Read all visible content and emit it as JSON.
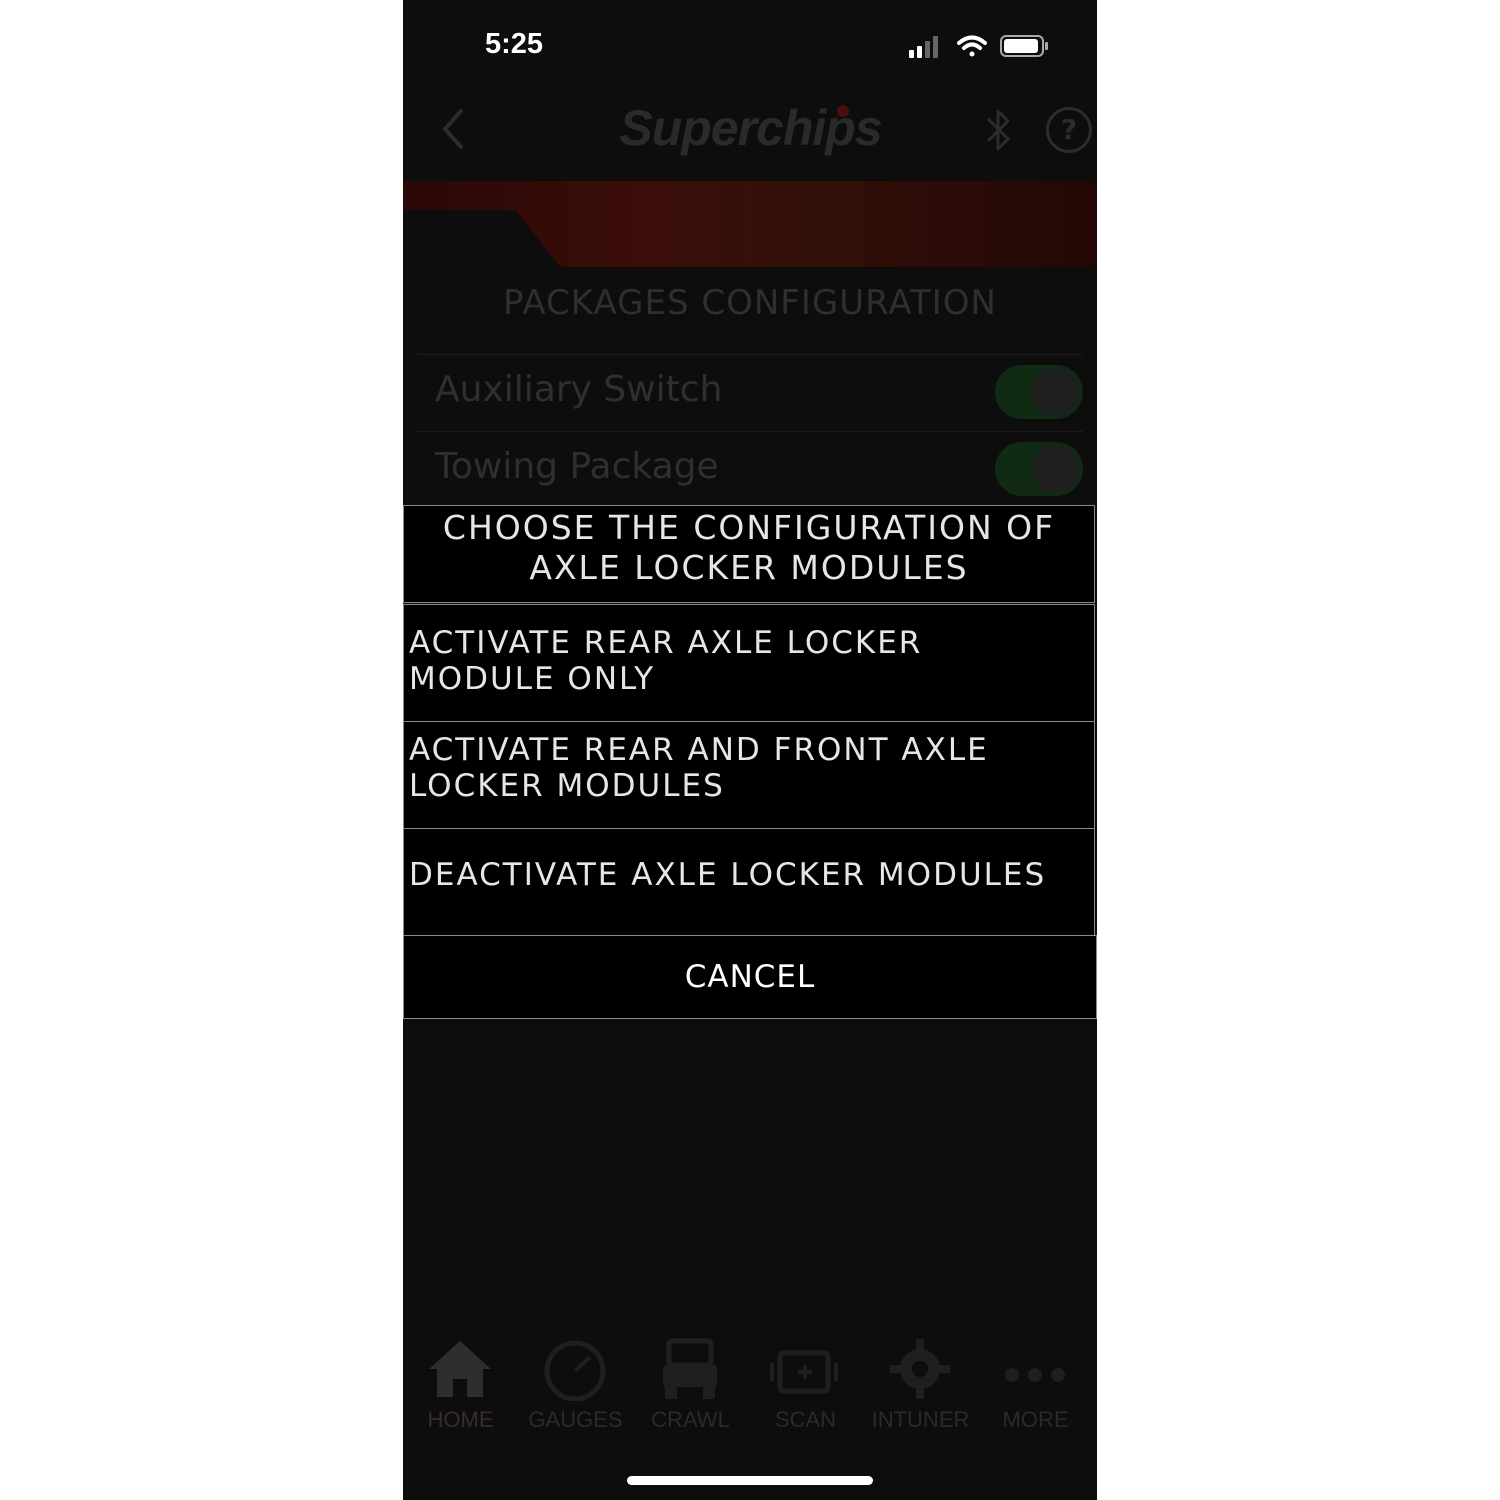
{
  "status_bar": {
    "time": "5:25"
  },
  "header": {
    "logo_text": "Superchips"
  },
  "section": {
    "title": "PACKAGES CONFIGURATION"
  },
  "rows": [
    {
      "label": "Auxiliary Switch"
    },
    {
      "label": "Towing Package"
    }
  ],
  "sheet": {
    "title_line1": "CHOOSE THE CONFIGURATION OF",
    "title_line2": "AXLE LOCKER MODULES",
    "options": [
      {
        "line1": "ACTIVATE REAR AXLE LOCKER",
        "line2": "MODULE ONLY"
      },
      {
        "line1": "ACTIVATE REAR AND FRONT AXLE",
        "line2": "LOCKER MODULES"
      },
      {
        "line1": "DEACTIVATE AXLE LOCKER MODULES",
        "line2": ""
      }
    ],
    "cancel_label": "CANCEL"
  },
  "tabs": [
    {
      "label": "HOME",
      "icon": "home-icon"
    },
    {
      "label": "GAUGES",
      "icon": "gauge-icon"
    },
    {
      "label": "CRAWL",
      "icon": "jeep-icon"
    },
    {
      "label": "SCAN",
      "icon": "engine-icon"
    },
    {
      "label": "INTUNER",
      "icon": "gear-icon"
    },
    {
      "label": "MORE",
      "icon": "more-icon"
    }
  ],
  "colors": {
    "accent_red": "#3b0d08",
    "toggle_on": "#102a14",
    "sheet_border": "#8a8a8a"
  }
}
